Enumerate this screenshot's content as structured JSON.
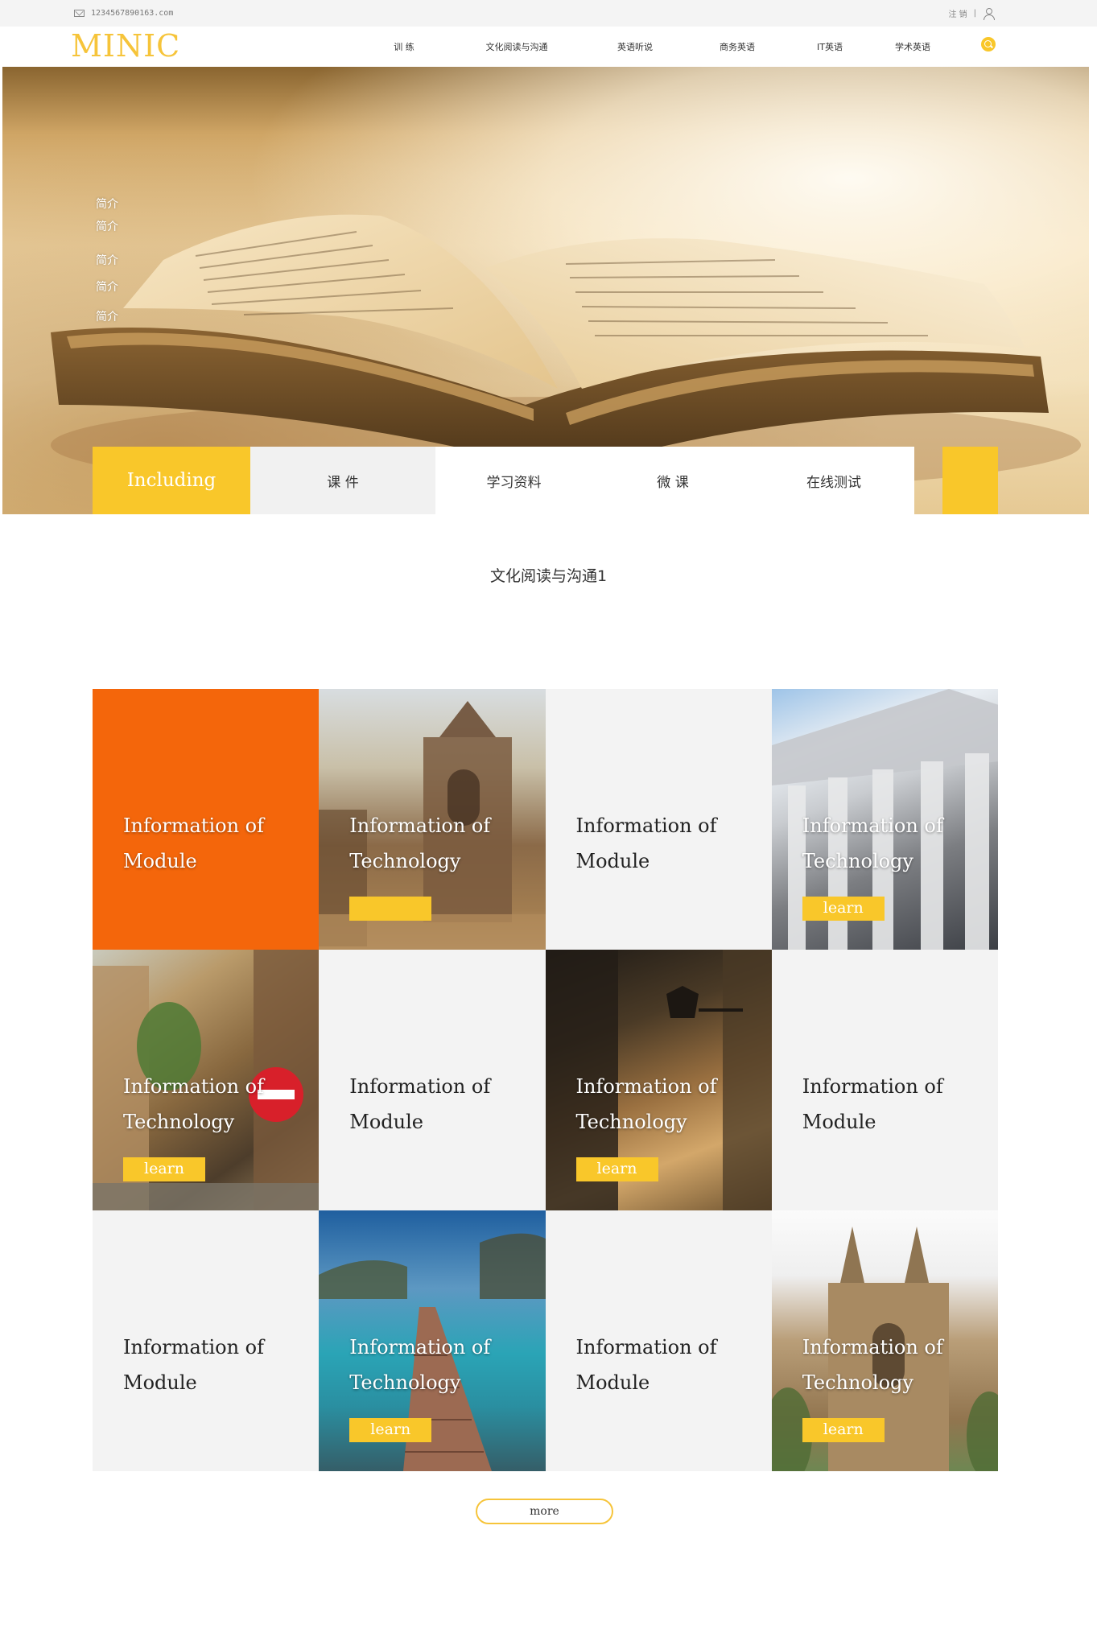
{
  "topbar": {
    "email": "1234567890163.com",
    "logout": "注 销",
    "divider": "|"
  },
  "header": {
    "logo": "MINIC",
    "nav": [
      "训 练",
      "文化阅读与沟通",
      "英语听说",
      "商务英语",
      "IT英语",
      "学术英语"
    ]
  },
  "hero": {
    "links": [
      "简介",
      "简介",
      "简介",
      "简介",
      "简介"
    ]
  },
  "tabs": {
    "including": "Including",
    "items": [
      "课 件",
      "学习资料",
      "微 课",
      "在线测试"
    ]
  },
  "section": {
    "title": "文化阅读与沟通1"
  },
  "tiles": [
    {
      "line1": "Information of",
      "line2": "Module",
      "style": "orange",
      "learn": ""
    },
    {
      "line1": "Information of",
      "line2": "Technology",
      "style": "photo",
      "learn": ""
    },
    {
      "line1": "Information of",
      "line2": "Module",
      "style": "light",
      "learn": ""
    },
    {
      "line1": "Information of",
      "line2": "Technology",
      "style": "photo",
      "learn": "learn"
    },
    {
      "line1": "Information of",
      "line2": "Technology",
      "style": "photo",
      "learn": "learn"
    },
    {
      "line1": "Information of",
      "line2": "Module",
      "style": "light",
      "learn": ""
    },
    {
      "line1": "Information of",
      "line2": "Technology",
      "style": "photo",
      "learn": "learn"
    },
    {
      "line1": "Information of",
      "line2": "Module",
      "style": "light",
      "learn": ""
    },
    {
      "line1": "Information of",
      "line2": "Module",
      "style": "light",
      "learn": ""
    },
    {
      "line1": "Information of",
      "line2": "Technology",
      "style": "photo",
      "learn": "learn"
    },
    {
      "line1": "Information of",
      "line2": "Module",
      "style": "light",
      "learn": ""
    },
    {
      "line1": "Information of",
      "line2": "Technology",
      "style": "photo",
      "learn": "learn"
    }
  ],
  "more": "more",
  "colors": {
    "accent": "#f9c72a",
    "orange": "#f4660b",
    "light": "#f3f3f3"
  }
}
